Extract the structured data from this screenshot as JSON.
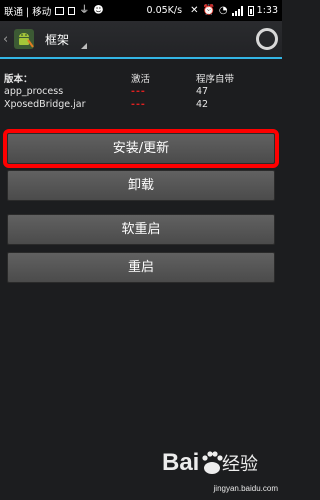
{
  "status_bar": {
    "carriers": "联通 | 移动",
    "icons": [
      "image-icon",
      "sim-card-icon",
      "usb-icon",
      "android-icon"
    ],
    "speed": "0.05K/s",
    "right_icons": [
      "mute-icon",
      "alarm-icon",
      "wifi-icon",
      "signal-icon",
      "battery-icon"
    ],
    "time": "1:33"
  },
  "action_bar": {
    "title": "框架",
    "app_icon": "xposed-android-icon",
    "busy_indicator": "progress-spinner-icon"
  },
  "version_table": {
    "headers": [
      "版本：",
      "激活",
      "程序自带"
    ],
    "rows": [
      {
        "name": "app_process",
        "active": "---",
        "bundled": "47"
      },
      {
        "name": "XposedBridge.jar",
        "active": "---",
        "bundled": "42"
      }
    ]
  },
  "buttons": {
    "install_update": "安装/更新",
    "uninstall": "卸载",
    "soft_reboot": "软重启",
    "reboot": "重启"
  },
  "highlight_color": "#ff0000",
  "accent_color": "#33b5e5",
  "watermark": {
    "logo_text": "Bai经验",
    "url": "jingyan.baidu.com"
  }
}
